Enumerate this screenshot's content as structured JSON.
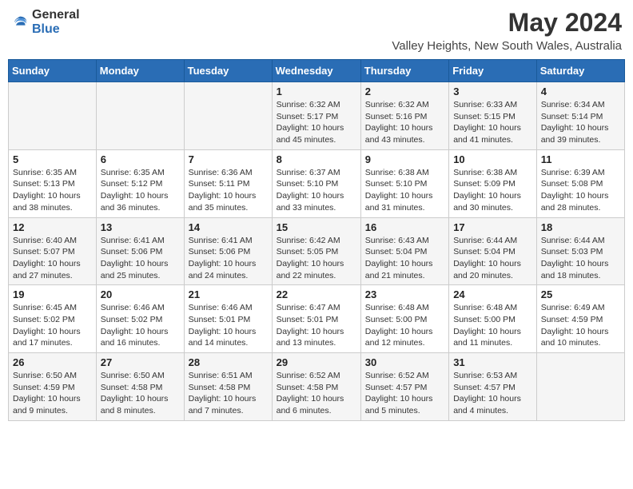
{
  "logo": {
    "general": "General",
    "blue": "Blue"
  },
  "title": "May 2024",
  "location": "Valley Heights, New South Wales, Australia",
  "headers": [
    "Sunday",
    "Monday",
    "Tuesday",
    "Wednesday",
    "Thursday",
    "Friday",
    "Saturday"
  ],
  "weeks": [
    [
      {
        "day": "",
        "info": ""
      },
      {
        "day": "",
        "info": ""
      },
      {
        "day": "",
        "info": ""
      },
      {
        "day": "1",
        "info": "Sunrise: 6:32 AM\nSunset: 5:17 PM\nDaylight: 10 hours\nand 45 minutes."
      },
      {
        "day": "2",
        "info": "Sunrise: 6:32 AM\nSunset: 5:16 PM\nDaylight: 10 hours\nand 43 minutes."
      },
      {
        "day": "3",
        "info": "Sunrise: 6:33 AM\nSunset: 5:15 PM\nDaylight: 10 hours\nand 41 minutes."
      },
      {
        "day": "4",
        "info": "Sunrise: 6:34 AM\nSunset: 5:14 PM\nDaylight: 10 hours\nand 39 minutes."
      }
    ],
    [
      {
        "day": "5",
        "info": "Sunrise: 6:35 AM\nSunset: 5:13 PM\nDaylight: 10 hours\nand 38 minutes."
      },
      {
        "day": "6",
        "info": "Sunrise: 6:35 AM\nSunset: 5:12 PM\nDaylight: 10 hours\nand 36 minutes."
      },
      {
        "day": "7",
        "info": "Sunrise: 6:36 AM\nSunset: 5:11 PM\nDaylight: 10 hours\nand 35 minutes."
      },
      {
        "day": "8",
        "info": "Sunrise: 6:37 AM\nSunset: 5:10 PM\nDaylight: 10 hours\nand 33 minutes."
      },
      {
        "day": "9",
        "info": "Sunrise: 6:38 AM\nSunset: 5:10 PM\nDaylight: 10 hours\nand 31 minutes."
      },
      {
        "day": "10",
        "info": "Sunrise: 6:38 AM\nSunset: 5:09 PM\nDaylight: 10 hours\nand 30 minutes."
      },
      {
        "day": "11",
        "info": "Sunrise: 6:39 AM\nSunset: 5:08 PM\nDaylight: 10 hours\nand 28 minutes."
      }
    ],
    [
      {
        "day": "12",
        "info": "Sunrise: 6:40 AM\nSunset: 5:07 PM\nDaylight: 10 hours\nand 27 minutes."
      },
      {
        "day": "13",
        "info": "Sunrise: 6:41 AM\nSunset: 5:06 PM\nDaylight: 10 hours\nand 25 minutes."
      },
      {
        "day": "14",
        "info": "Sunrise: 6:41 AM\nSunset: 5:06 PM\nDaylight: 10 hours\nand 24 minutes."
      },
      {
        "day": "15",
        "info": "Sunrise: 6:42 AM\nSunset: 5:05 PM\nDaylight: 10 hours\nand 22 minutes."
      },
      {
        "day": "16",
        "info": "Sunrise: 6:43 AM\nSunset: 5:04 PM\nDaylight: 10 hours\nand 21 minutes."
      },
      {
        "day": "17",
        "info": "Sunrise: 6:44 AM\nSunset: 5:04 PM\nDaylight: 10 hours\nand 20 minutes."
      },
      {
        "day": "18",
        "info": "Sunrise: 6:44 AM\nSunset: 5:03 PM\nDaylight: 10 hours\nand 18 minutes."
      }
    ],
    [
      {
        "day": "19",
        "info": "Sunrise: 6:45 AM\nSunset: 5:02 PM\nDaylight: 10 hours\nand 17 minutes."
      },
      {
        "day": "20",
        "info": "Sunrise: 6:46 AM\nSunset: 5:02 PM\nDaylight: 10 hours\nand 16 minutes."
      },
      {
        "day": "21",
        "info": "Sunrise: 6:46 AM\nSunset: 5:01 PM\nDaylight: 10 hours\nand 14 minutes."
      },
      {
        "day": "22",
        "info": "Sunrise: 6:47 AM\nSunset: 5:01 PM\nDaylight: 10 hours\nand 13 minutes."
      },
      {
        "day": "23",
        "info": "Sunrise: 6:48 AM\nSunset: 5:00 PM\nDaylight: 10 hours\nand 12 minutes."
      },
      {
        "day": "24",
        "info": "Sunrise: 6:48 AM\nSunset: 5:00 PM\nDaylight: 10 hours\nand 11 minutes."
      },
      {
        "day": "25",
        "info": "Sunrise: 6:49 AM\nSunset: 4:59 PM\nDaylight: 10 hours\nand 10 minutes."
      }
    ],
    [
      {
        "day": "26",
        "info": "Sunrise: 6:50 AM\nSunset: 4:59 PM\nDaylight: 10 hours\nand 9 minutes."
      },
      {
        "day": "27",
        "info": "Sunrise: 6:50 AM\nSunset: 4:58 PM\nDaylight: 10 hours\nand 8 minutes."
      },
      {
        "day": "28",
        "info": "Sunrise: 6:51 AM\nSunset: 4:58 PM\nDaylight: 10 hours\nand 7 minutes."
      },
      {
        "day": "29",
        "info": "Sunrise: 6:52 AM\nSunset: 4:58 PM\nDaylight: 10 hours\nand 6 minutes."
      },
      {
        "day": "30",
        "info": "Sunrise: 6:52 AM\nSunset: 4:57 PM\nDaylight: 10 hours\nand 5 minutes."
      },
      {
        "day": "31",
        "info": "Sunrise: 6:53 AM\nSunset: 4:57 PM\nDaylight: 10 hours\nand 4 minutes."
      },
      {
        "day": "",
        "info": ""
      }
    ]
  ]
}
